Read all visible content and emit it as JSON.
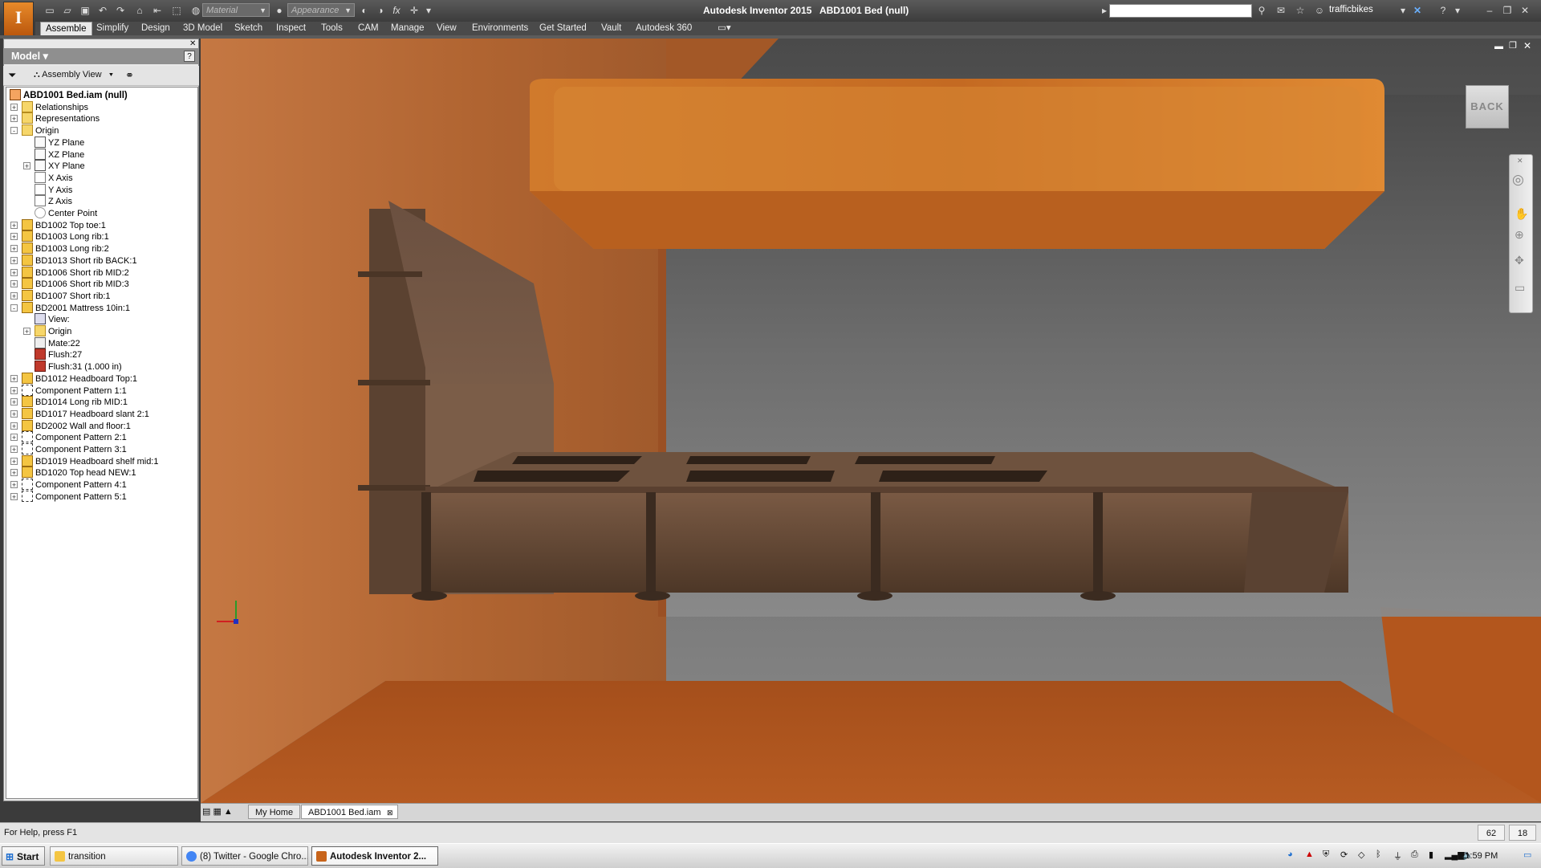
{
  "app": {
    "title": "Autodesk Inventor 2015",
    "document": "ABD1001 Bed (null)",
    "user": "trafficbikes",
    "app_icon_letter": "I"
  },
  "quick_access": {
    "material_placeholder": "Material",
    "appearance_placeholder": "Appearance",
    "fx_label": "fx"
  },
  "ribbon_tabs": [
    "Assemble",
    "Simplify",
    "Design",
    "3D Model",
    "Sketch",
    "Inspect",
    "Tools",
    "CAM",
    "Manage",
    "View",
    "Environments",
    "Get Started",
    "Vault",
    "Autodesk 360"
  ],
  "browser": {
    "title": "Model ▾",
    "view_label": "Assembly View",
    "nodes": [
      {
        "label": "ABD1001 Bed.iam (null)",
        "icon": "root",
        "level": 0,
        "expand": "-"
      },
      {
        "label": "Relationships",
        "icon": "folder",
        "level": 1,
        "expand": "+"
      },
      {
        "label": "Representations",
        "icon": "folder",
        "level": 1,
        "expand": "+"
      },
      {
        "label": "Origin",
        "icon": "folder",
        "level": 1,
        "expand": "-"
      },
      {
        "label": "YZ Plane",
        "icon": "plane",
        "level": 2,
        "expand": ""
      },
      {
        "label": "XZ Plane",
        "icon": "plane",
        "level": 2,
        "expand": ""
      },
      {
        "label": "XY Plane",
        "icon": "plane",
        "level": 2,
        "expand": "+"
      },
      {
        "label": "X Axis",
        "icon": "axis",
        "level": 2,
        "expand": ""
      },
      {
        "label": "Y Axis",
        "icon": "axis",
        "level": 2,
        "expand": ""
      },
      {
        "label": "Z Axis",
        "icon": "axis",
        "level": 2,
        "expand": ""
      },
      {
        "label": "Center Point",
        "icon": "point",
        "level": 2,
        "expand": ""
      },
      {
        "label": "BD1002 Top toe:1",
        "icon": "part",
        "level": 1,
        "expand": "+"
      },
      {
        "label": "BD1003 Long rib:1",
        "icon": "part",
        "level": 1,
        "expand": "+"
      },
      {
        "label": "BD1003 Long rib:2",
        "icon": "part",
        "level": 1,
        "expand": "+"
      },
      {
        "label": "BD1013 Short rib BACK:1",
        "icon": "part",
        "level": 1,
        "expand": "+"
      },
      {
        "label": "BD1006 Short rib MID:2",
        "icon": "part",
        "level": 1,
        "expand": "+"
      },
      {
        "label": "BD1006 Short rib MID:3",
        "icon": "part",
        "level": 1,
        "expand": "+"
      },
      {
        "label": "BD1007 Short rib:1",
        "icon": "part",
        "level": 1,
        "expand": "+"
      },
      {
        "label": "BD2001 Mattress 10in:1",
        "icon": "part",
        "level": 1,
        "expand": "-"
      },
      {
        "label": "View:",
        "icon": "view",
        "level": 2,
        "expand": ""
      },
      {
        "label": "Origin",
        "icon": "folder",
        "level": 2,
        "expand": "+"
      },
      {
        "label": "Mate:22",
        "icon": "mate",
        "level": 2,
        "expand": ""
      },
      {
        "label": "Flush:27",
        "icon": "flush",
        "level": 2,
        "expand": ""
      },
      {
        "label": "Flush:31 (1.000 in)",
        "icon": "flush",
        "level": 2,
        "expand": ""
      },
      {
        "label": "BD1012 Headboard Top:1",
        "icon": "part",
        "level": 1,
        "expand": "+"
      },
      {
        "label": "Component Pattern 1:1",
        "icon": "pattern",
        "level": 1,
        "expand": "+"
      },
      {
        "label": "BD1014 Long rib MID:1",
        "icon": "part",
        "level": 1,
        "expand": "+"
      },
      {
        "label": "BD1017 Headboard slant 2:1",
        "icon": "part",
        "level": 1,
        "expand": "+"
      },
      {
        "label": "BD2002 Wall and floor:1",
        "icon": "part",
        "level": 1,
        "expand": "+"
      },
      {
        "label": "Component Pattern 2:1",
        "icon": "pattern",
        "level": 1,
        "expand": "+"
      },
      {
        "label": "Component Pattern 3:1",
        "icon": "pattern",
        "level": 1,
        "expand": "+"
      },
      {
        "label": "BD1019 Headboard shelf mid:1",
        "icon": "part",
        "level": 1,
        "expand": "+"
      },
      {
        "label": "BD1020 Top head NEW:1",
        "icon": "part",
        "level": 1,
        "expand": "+"
      },
      {
        "label": "Component Pattern 4:1",
        "icon": "pattern",
        "level": 1,
        "expand": "+"
      },
      {
        "label": "Component Pattern 5:1",
        "icon": "pattern",
        "level": 1,
        "expand": "+"
      }
    ]
  },
  "viewcube": {
    "label": "BACK"
  },
  "doc_tabs": {
    "home": "My Home",
    "active": "ABD1001 Bed.iam"
  },
  "status": {
    "help": "For Help, press F1",
    "count1": "62",
    "count2": "18"
  },
  "taskbar": {
    "start": "Start",
    "tasks": [
      {
        "label": "transition",
        "active": false
      },
      {
        "label": "(8) Twitter - Google Chro...",
        "active": false
      },
      {
        "label": "Autodesk Inventor 2...",
        "active": true
      }
    ],
    "clock": "11:59 PM"
  },
  "colors": {
    "accent_orange": "#c8641a",
    "wall": "#b86a34",
    "floor": "#b5581f",
    "wood": "#6b4e3a"
  }
}
